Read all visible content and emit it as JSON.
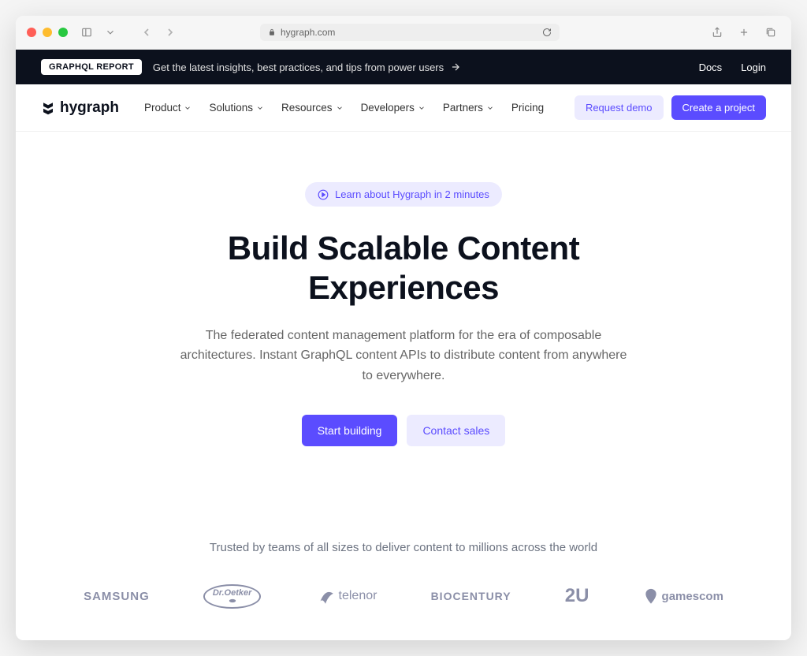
{
  "browser": {
    "url": "hygraph.com"
  },
  "announcement": {
    "badge": "GRAPHQL REPORT",
    "text": "Get the latest insights, best practices, and tips from power users",
    "docs": "Docs",
    "login": "Login"
  },
  "nav": {
    "logo": "hygraph",
    "items": [
      {
        "label": "Product",
        "dropdown": true
      },
      {
        "label": "Solutions",
        "dropdown": true
      },
      {
        "label": "Resources",
        "dropdown": true
      },
      {
        "label": "Developers",
        "dropdown": true
      },
      {
        "label": "Partners",
        "dropdown": true
      },
      {
        "label": "Pricing",
        "dropdown": false
      }
    ],
    "request_demo": "Request demo",
    "create_project": "Create a project"
  },
  "hero": {
    "learn_pill": "Learn about Hygraph in 2 minutes",
    "heading": "Build Scalable Content Experiences",
    "subheading": "The federated content management platform for the era of composable architectures. Instant GraphQL content APIs to distribute content from anywhere to everywhere.",
    "start_building": "Start building",
    "contact_sales": "Contact sales"
  },
  "trusted": {
    "title": "Trusted by teams of all sizes to deliver content to millions across the world",
    "logos": {
      "samsung": "SAMSUNG",
      "oetker": "Dr.Oetker",
      "telenor": "telenor",
      "biocentury": "BIOCENTURY",
      "twou": "2U",
      "gamescom": "gamescom"
    }
  }
}
